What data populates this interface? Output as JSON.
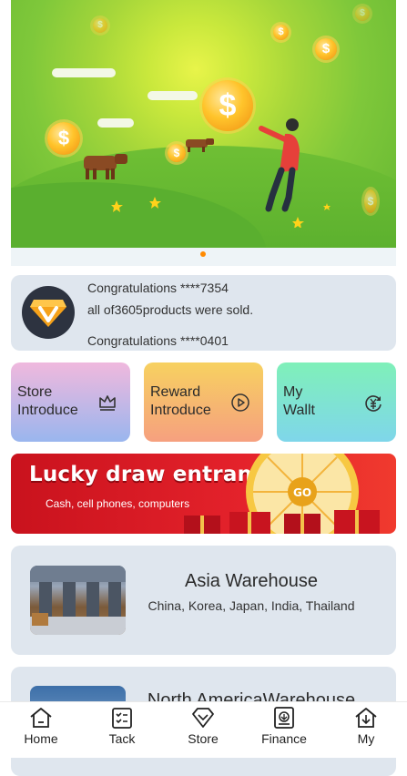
{
  "notice": {
    "lines": [
      "Congratulations ****7354",
      "all of3605products were sold.",
      "Congratulations ****0401"
    ]
  },
  "cards": [
    {
      "line1": "Store",
      "line2": "Introduce",
      "icon": "crown-icon"
    },
    {
      "line1": "Reward",
      "line2": "Introduce",
      "icon": "play-icon"
    },
    {
      "line1": "My",
      "line2": "Wallt",
      "icon": "yen-refresh-icon"
    }
  ],
  "lucky": {
    "title": "Lucky draw entrance",
    "subtitle": "Cash, cell phones, computers",
    "wheel_label": "GO"
  },
  "warehouses": [
    {
      "name": "Asia Warehouse",
      "desc": "China, Korea, Japan, India, Thailand"
    },
    {
      "name": "North AmericaWarehouse",
      "desc": ""
    }
  ],
  "tabs": [
    {
      "label": "Home",
      "icon": "home-icon"
    },
    {
      "label": "Tack",
      "icon": "task-list-icon"
    },
    {
      "label": "Store",
      "icon": "diamond-icon"
    },
    {
      "label": "Finance",
      "icon": "finance-icon"
    },
    {
      "label": "My",
      "icon": "user-home-icon"
    }
  ],
  "colors": {
    "accent": "#ff8a00",
    "card_bg": "#dfe6ee",
    "lucky_red": "#e4222b"
  }
}
